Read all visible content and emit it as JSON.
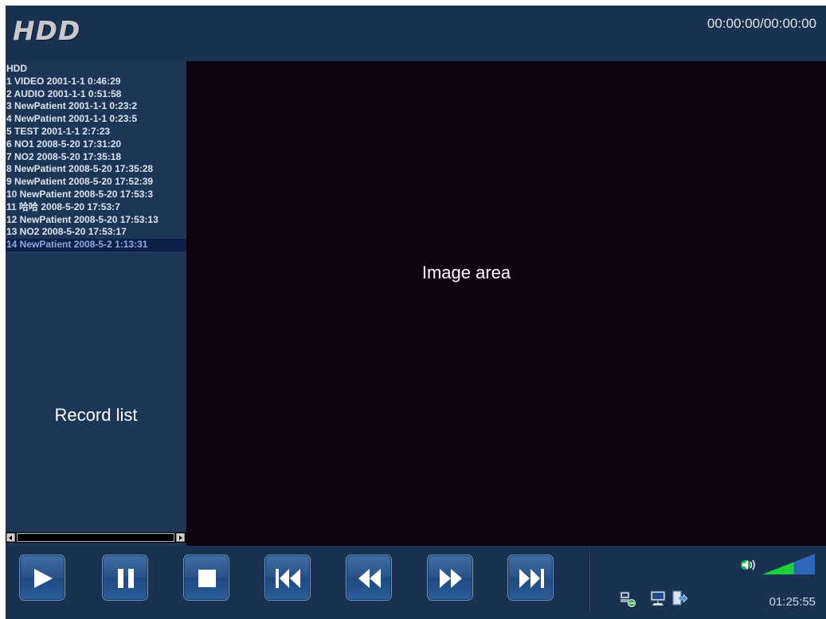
{
  "header": {
    "logo": "HDD",
    "timecode": "00:00:00/00:00:00"
  },
  "record_list": {
    "items": [
      "HDD",
      "1 VIDEO 2001-1-1 0:46:29",
      "2 AUDIO 2001-1-1 0:51:58",
      "3 NewPatient 2001-1-1 0:23:2",
      "4 NewPatient 2001-1-1 0:23:5",
      "5 TEST 2001-1-1 2:7:23",
      "6 NO1 2008-5-20 17:31:20",
      "7 NO2 2008-5-20 17:35:18",
      "8 NewPatient 2008-5-20 17:35:28",
      "9 NewPatient 2008-5-20 17:52:39",
      "10 NewPatient 2008-5-20 17:53:3",
      "11 哈哈 2008-5-20 17:53:7",
      "12 NewPatient 2008-5-20 17:53:13",
      "13 NO2 2008-5-20 17:53:17",
      "14 NewPatient 2008-5-2 1:13:31"
    ],
    "selected": "14 NewPatient 2008-5-2 1:13:31",
    "label": "Record list"
  },
  "image_area": {
    "label": "Image area"
  },
  "controls": {
    "buttons": [
      "play-icon",
      "pause-icon",
      "stop-icon",
      "skip-to-start-icon",
      "rewind-icon",
      "fast-forward-icon",
      "skip-to-end-icon"
    ]
  },
  "status": {
    "icons": [
      "network-icon",
      "monitor-icon",
      "exit-icon",
      "speaker-icon"
    ],
    "volume_level": 0.6,
    "clock": "01:25:55",
    "colors": {
      "volume_fill": "#1fcf3a",
      "volume_empty": "#2f67b8"
    }
  }
}
